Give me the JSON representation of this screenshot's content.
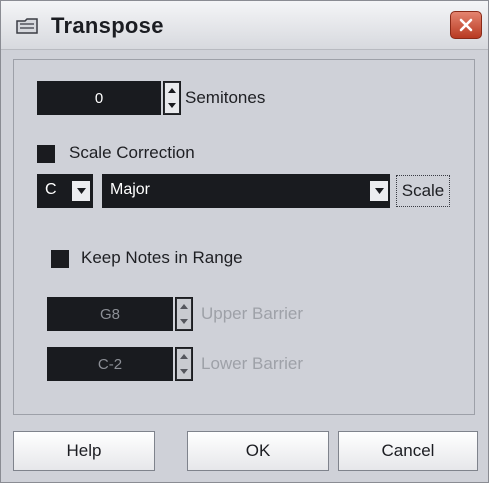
{
  "window": {
    "title": "Transpose"
  },
  "semitones": {
    "value": "0",
    "label": "Semitones"
  },
  "scale_correction": {
    "label": "Scale Correction",
    "root_note": "C",
    "scale_type": "Major",
    "scale_button": "Scale"
  },
  "range": {
    "keep_label": "Keep Notes in Range",
    "upper_value": "G8",
    "upper_label": "Upper Barrier",
    "lower_value": "C-2",
    "lower_label": "Lower Barrier"
  },
  "buttons": {
    "help": "Help",
    "ok": "OK",
    "cancel": "Cancel"
  },
  "icons": {
    "app": "transpose-icon",
    "close": "close-icon",
    "spin_up": "arrow-up-icon",
    "spin_down": "arrow-down-icon",
    "dropdown": "chevron-down-icon"
  }
}
